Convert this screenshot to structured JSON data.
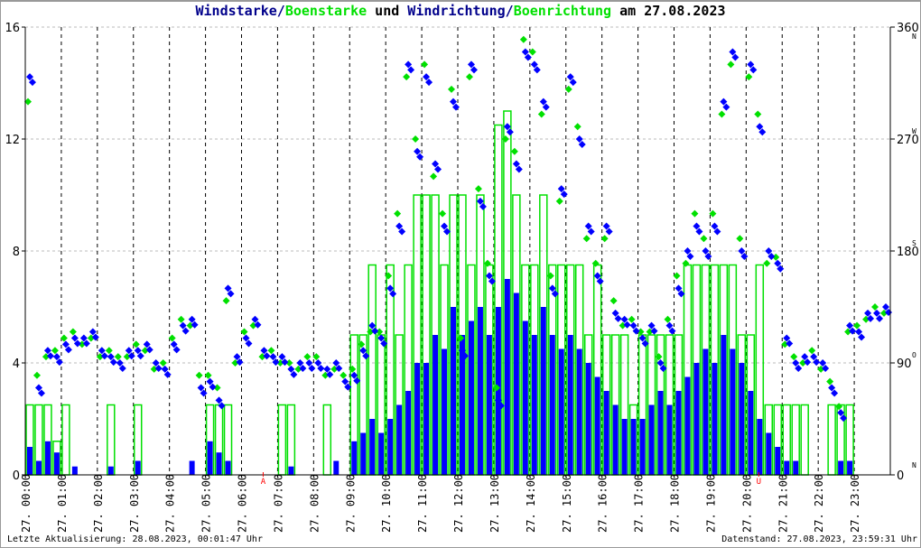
{
  "title": {
    "part1": "Windstarke/",
    "part2": "Boenstarke",
    "part3": " und ",
    "part4": "Windrichtung/",
    "part5": "Boenrichtung",
    "part6": " am 27.08.2023"
  },
  "footer": {
    "left": "Letzte Aktualisierung: 28.08.2023, 00:01:47 Uhr",
    "right": "Datenstand: 27.08.2023, 23:59:31 Uhr"
  },
  "chart_data": {
    "type": "bar",
    "title": "Windstarke/Boenstarke und Windrichtung/Boenrichtung am 27.08.2023",
    "colors": {
      "speed": "#0000ff",
      "gust": "#00e000",
      "marker": "#ff0000"
    },
    "x_tick_labels": [
      "27. 00:00",
      "27. 01:00",
      "27. 02:00",
      "27. 03:00",
      "27. 04:00",
      "27. 05:00",
      "27. 06:00",
      "27. 07:00",
      "27. 08:00",
      "27. 09:00",
      "27. 10:00",
      "27. 11:00",
      "27. 12:00",
      "27. 13:00",
      "27. 14:00",
      "27. 15:00",
      "27. 16:00",
      "27. 17:00",
      "27. 18:00",
      "27. 19:00",
      "27. 20:00",
      "27. 21:00",
      "27. 22:00",
      "27. 23:00"
    ],
    "y_left": {
      "ticks": [
        "0",
        "4",
        "8",
        "12",
        "16"
      ],
      "range": [
        0,
        16
      ]
    },
    "y_right": {
      "ticks": [
        "0",
        "90",
        "180",
        "270",
        "360"
      ],
      "compass": [
        "N",
        "O",
        "S",
        "W",
        "N"
      ],
      "range": [
        0,
        360
      ]
    },
    "markers": [
      {
        "label": "A",
        "hour": 6.6
      },
      {
        "label": "U",
        "hour": 20.35
      }
    ],
    "interval_minutes": 15,
    "speed": [
      1,
      0.5,
      1.2,
      0.8,
      0,
      0.3,
      0,
      0,
      0,
      0.3,
      0,
      0,
      0.5,
      0,
      0,
      0,
      0,
      0,
      0.5,
      0,
      1.2,
      0.8,
      0.5,
      0,
      0,
      0,
      0,
      0,
      0,
      0.3,
      0,
      0,
      0,
      0,
      0.5,
      0,
      1.2,
      1.5,
      2,
      1.5,
      2,
      2.5,
      3,
      4,
      4,
      5,
      4.5,
      6,
      5,
      5.5,
      6,
      5,
      6,
      7,
      6.5,
      5.5,
      5,
      6,
      5,
      4.5,
      5,
      4.5,
      4,
      3.5,
      3,
      2.5,
      2,
      2,
      2,
      2.5,
      3,
      2.5,
      3,
      3.5,
      4,
      4.5,
      4,
      5,
      4.5,
      4,
      3,
      2,
      1.5,
      1,
      0.5,
      0.5,
      0,
      0,
      0,
      0,
      0.5,
      0.5,
      0,
      0,
      0,
      0
    ],
    "gust": [
      2.5,
      2.5,
      2.5,
      1.2,
      2.5,
      0,
      0,
      0,
      0,
      2.5,
      0,
      0,
      2.5,
      0,
      0,
      0,
      0,
      0,
      0,
      0,
      2.5,
      2.5,
      2.5,
      0,
      0,
      0,
      0,
      0,
      2.5,
      2.5,
      0,
      0,
      0,
      2.5,
      0,
      0,
      5,
      5,
      7.5,
      5,
      7.5,
      5,
      7.5,
      10,
      10,
      10,
      7.5,
      10,
      10,
      7.5,
      10,
      7.5,
      12.5,
      13,
      10,
      7.5,
      7.5,
      10,
      7.5,
      7.5,
      7.5,
      7.5,
      5,
      7.5,
      5,
      5,
      5,
      2.5,
      5,
      5,
      5,
      5,
      5,
      7.5,
      7.5,
      7.5,
      7.5,
      7.5,
      7.5,
      5,
      5,
      7.5,
      2.5,
      2.5,
      2.5,
      2.5,
      2.5,
      0,
      0,
      2.5,
      2.5,
      2.5,
      0,
      0,
      0,
      0
    ],
    "direction": [
      320,
      70,
      100,
      95,
      105,
      110,
      110,
      115,
      100,
      95,
      90,
      100,
      100,
      105,
      90,
      85,
      105,
      120,
      125,
      70,
      75,
      60,
      150,
      95,
      110,
      125,
      100,
      95,
      95,
      85,
      90,
      90,
      90,
      85,
      90,
      75,
      80,
      100,
      120,
      110,
      150,
      200,
      330,
      260,
      320,
      250,
      200,
      300,
      100,
      330,
      220,
      160,
      60,
      280,
      250,
      340,
      330,
      300,
      150,
      230,
      320,
      270,
      200,
      160,
      200,
      130,
      125,
      120,
      110,
      120,
      90,
      120,
      150,
      180,
      200,
      180,
      200,
      300,
      340,
      180,
      330,
      280,
      180,
      170,
      110,
      90,
      95,
      95,
      90,
      70,
      50,
      120,
      115,
      130,
      130,
      135
    ],
    "gust_direction": [
      300,
      80,
      95,
      100,
      110,
      115,
      105,
      110,
      95,
      100,
      95,
      95,
      105,
      100,
      85,
      90,
      110,
      125,
      120,
      80,
      80,
      70,
      140,
      90,
      115,
      120,
      95,
      100,
      90,
      90,
      85,
      95,
      95,
      80,
      85,
      80,
      85,
      105,
      115,
      115,
      160,
      210,
      320,
      270,
      330,
      240,
      210,
      310,
      110,
      320,
      230,
      170,
      70,
      270,
      260,
      350,
      340,
      290,
      160,
      220,
      310,
      280,
      190,
      170,
      190,
      140,
      120,
      125,
      115,
      115,
      95,
      125,
      160,
      170,
      210,
      190,
      210,
      290,
      330,
      190,
      320,
      290,
      170,
      175,
      105,
      95,
      90,
      100,
      85,
      75,
      55,
      115,
      120,
      125,
      135,
      130
    ]
  }
}
